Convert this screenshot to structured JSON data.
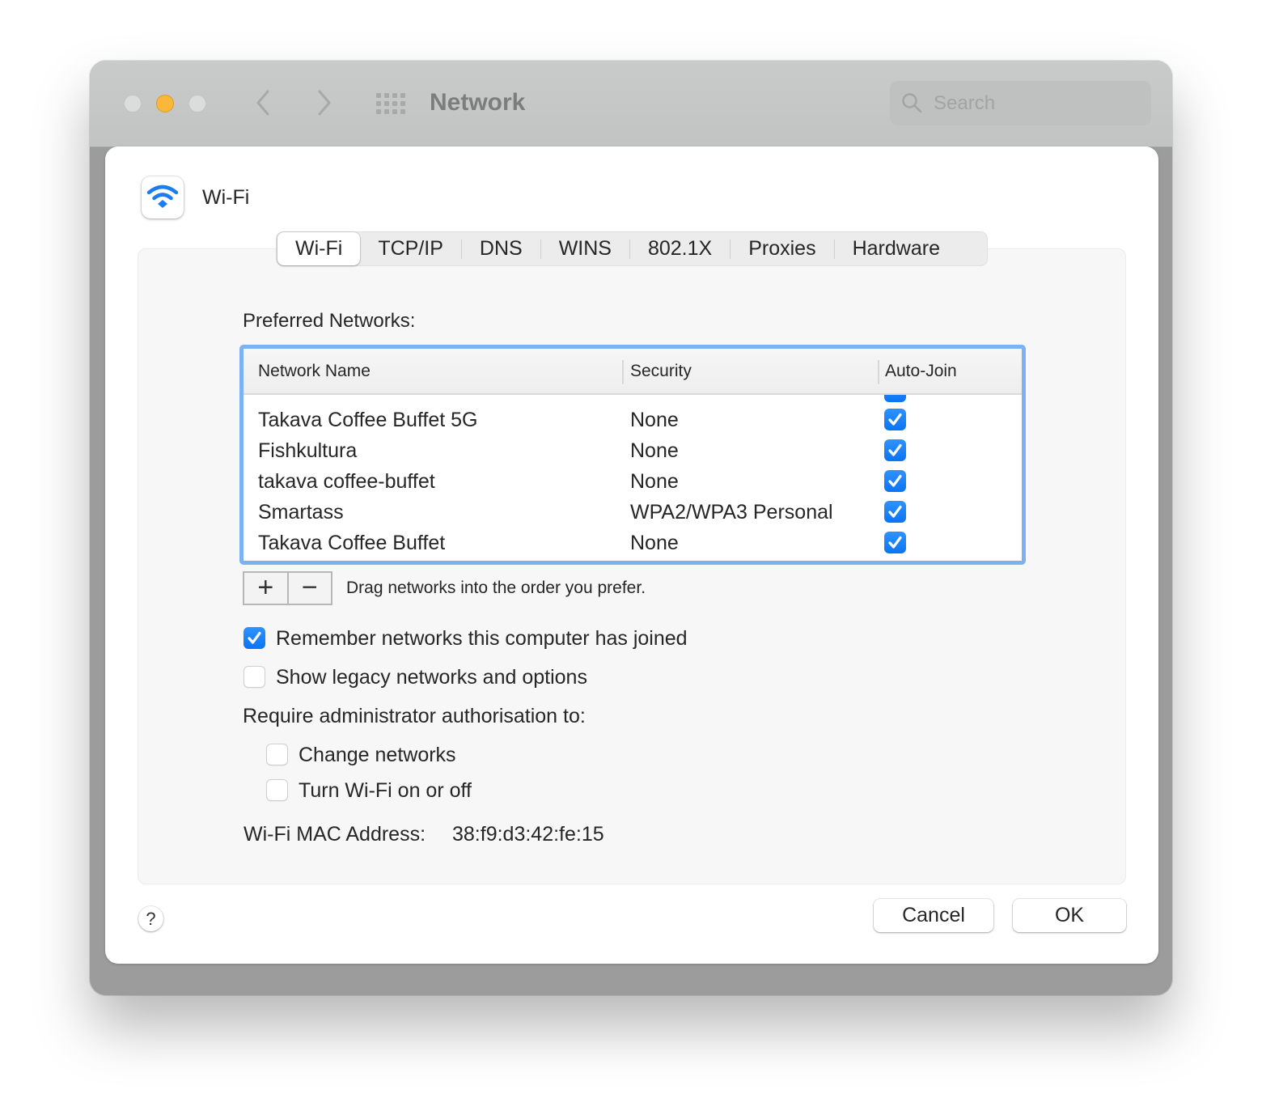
{
  "window": {
    "title": "Network",
    "search_placeholder": "Search",
    "traffic_lights": [
      "close",
      "minimize",
      "zoom"
    ]
  },
  "sheet": {
    "service_name": "Wi-Fi",
    "icon": "wifi-icon",
    "tabs": [
      {
        "label": "Wi-Fi",
        "active": true
      },
      {
        "label": "TCP/IP",
        "active": false
      },
      {
        "label": "DNS",
        "active": false
      },
      {
        "label": "WINS",
        "active": false
      },
      {
        "label": "802.1X",
        "active": false
      },
      {
        "label": "Proxies",
        "active": false
      },
      {
        "label": "Hardware",
        "active": false
      }
    ],
    "preferred_networks_label": "Preferred Networks:",
    "table": {
      "columns": [
        "Network Name",
        "Security",
        "Auto-Join"
      ],
      "rows": [
        {
          "name": "Takava Coffee Buffet 5G",
          "security": "None",
          "auto_join": true
        },
        {
          "name": "Fishkultura",
          "security": "None",
          "auto_join": true
        },
        {
          "name": "takava coffee-buffet",
          "security": "None",
          "auto_join": true
        },
        {
          "name": "Smartass",
          "security": "WPA2/WPA3 Personal",
          "auto_join": true
        },
        {
          "name": "Takava Coffee Buffet",
          "security": "None",
          "auto_join": true
        }
      ]
    },
    "add_label": "+",
    "remove_label": "−",
    "drag_hint": "Drag networks into the order you prefer.",
    "options": [
      {
        "label": "Remember networks this computer has joined",
        "checked": true
      },
      {
        "label": "Show legacy networks and options",
        "checked": false
      }
    ],
    "require_admin_label": "Require administrator authorisation to:",
    "admin_options": [
      {
        "label": "Change networks",
        "checked": false
      },
      {
        "label": "Turn Wi-Fi on or off",
        "checked": false
      }
    ],
    "mac_label": "Wi-Fi MAC Address:",
    "mac_value": "38:f9:d3:42:fe:15",
    "help_label": "?",
    "cancel_label": "Cancel",
    "ok_label": "OK"
  },
  "colors": {
    "accent": "#0a74f2",
    "focus_ring": "#7eb1f2",
    "minimize_light": "#fbb73a"
  }
}
